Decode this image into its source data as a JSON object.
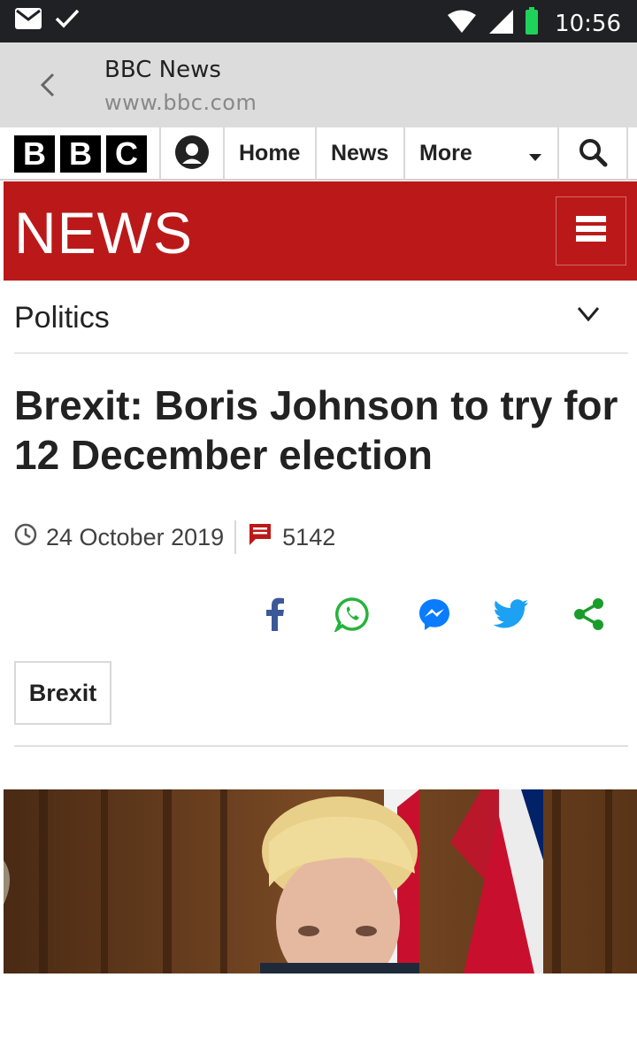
{
  "status_bar": {
    "time": "10:56",
    "icons": [
      "mail-icon",
      "check-icon",
      "wifi-icon",
      "signal-icon",
      "battery-icon"
    ],
    "battery_color": "#1fd35a"
  },
  "browser_bar": {
    "title": "BBC News",
    "url": "www.bbc.com"
  },
  "bbc_nav": {
    "logo_letters": [
      "B",
      "B",
      "C"
    ],
    "items": [
      {
        "label": "Home"
      },
      {
        "label": "News"
      },
      {
        "label": "More"
      }
    ]
  },
  "news_banner": {
    "title": "NEWS",
    "color": "#bb1919"
  },
  "section": {
    "label": "Politics"
  },
  "article": {
    "headline": "Brexit: Boris Johnson to try for 12 December election",
    "date": "24 October 2019",
    "comments": "5142",
    "tag": "Brexit"
  },
  "share": {
    "icons": [
      "facebook-icon",
      "whatsapp-icon",
      "messenger-icon",
      "twitter-icon",
      "share-icon"
    ],
    "colors": {
      "facebook": "#3b5998",
      "whatsapp": "#25b33c",
      "messenger": "#0a7cff",
      "twitter": "#1da1f2",
      "share": "#1a9c2a"
    }
  }
}
